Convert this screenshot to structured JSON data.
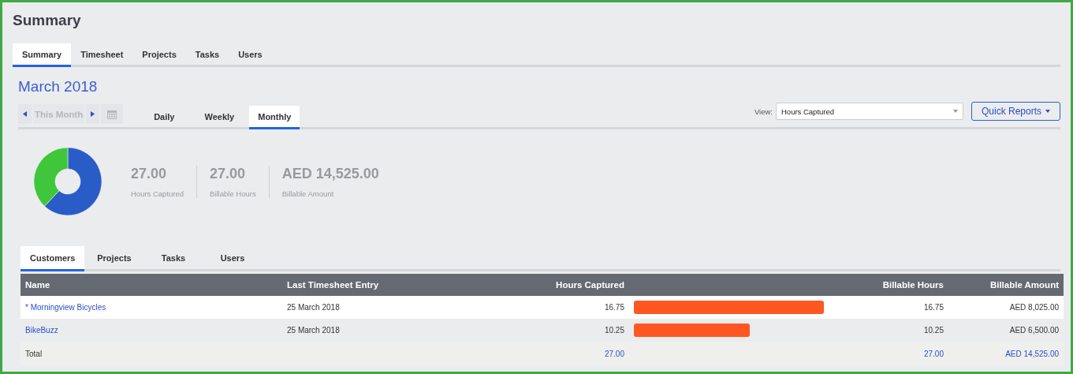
{
  "page_title": "Summary",
  "tabs": [
    {
      "label": "Summary",
      "selected": true
    },
    {
      "label": "Timesheet",
      "selected": false
    },
    {
      "label": "Projects",
      "selected": false
    },
    {
      "label": "Tasks",
      "selected": false
    },
    {
      "label": "Users",
      "selected": false
    }
  ],
  "period_title": "March 2018",
  "period_nav": {
    "label": "This Month",
    "disabled": true
  },
  "period_tabs": [
    {
      "label": "Daily",
      "selected": false
    },
    {
      "label": "Weekly",
      "selected": false
    },
    {
      "label": "Monthly",
      "selected": true
    }
  ],
  "view": {
    "label": "View:",
    "value": "Hours Captured"
  },
  "quick_reports": "Quick Reports",
  "stats": [
    {
      "value": "27.00",
      "label": "Hours Captured"
    },
    {
      "value": "27.00",
      "label": "Billable Hours"
    },
    {
      "value": "AED 14,525.00",
      "label": "Billable Amount"
    }
  ],
  "detail_tabs": [
    {
      "label": "Customers",
      "selected": true
    },
    {
      "label": "Projects",
      "selected": false
    },
    {
      "label": "Tasks",
      "selected": false
    },
    {
      "label": "Users",
      "selected": false
    }
  ],
  "table": {
    "columns": [
      "Name",
      "Last Timesheet Entry",
      "Hours Captured",
      "Billable Hours",
      "Billable Amount"
    ],
    "rows": [
      {
        "name": "* Morningview Bicycles",
        "last_entry": "25 March 2018",
        "hours": "16.75",
        "level": 1,
        "billable_hours": "16.75",
        "amount": "AED 8,025.00"
      },
      {
        "name": "BikeBuzz",
        "last_entry": "25 March 2018",
        "hours": "10.25",
        "level": 0.61,
        "billable_hours": "10.25",
        "amount": "AED 6,500.00"
      }
    ],
    "total": {
      "label": "Total",
      "hours": "27.00",
      "billable_hours": "27.00",
      "amount": "AED 14,525.00"
    }
  }
}
